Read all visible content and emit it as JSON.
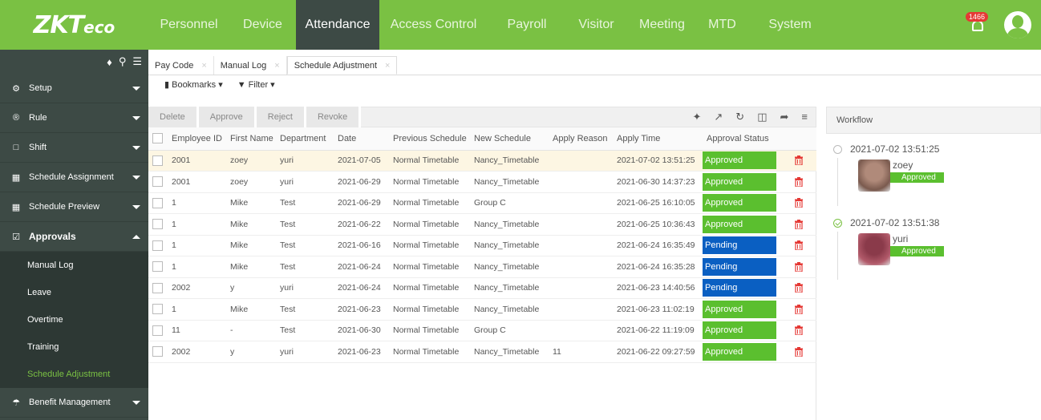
{
  "brand": {
    "logo_main": "ZKT",
    "logo_sub": "eco",
    "accent": "#7ac143",
    "dark": "#3d4a45"
  },
  "topnav": {
    "items": [
      "Personnel",
      "Device",
      "Attendance",
      "Access Control",
      "Payroll",
      "Visitor",
      "Meeting",
      "MTD",
      "System"
    ],
    "active": "Attendance",
    "notifications": "1466"
  },
  "sidebar": {
    "items": [
      {
        "label": "Setup",
        "icon": "gear-icon"
      },
      {
        "label": "Rule",
        "icon": "registered-icon"
      },
      {
        "label": "Shift",
        "icon": "folder-icon"
      },
      {
        "label": "Schedule Assignment",
        "icon": "calendar-icon"
      },
      {
        "label": "Schedule Preview",
        "icon": "calendar-icon"
      },
      {
        "label": "Approvals",
        "icon": "checkbox-icon"
      }
    ],
    "sub_items": [
      "Manual Log",
      "Leave",
      "Overtime",
      "Training",
      "Schedule Adjustment"
    ],
    "bottom_item": {
      "label": "Benefit Management",
      "icon": "umbrella-icon"
    }
  },
  "tabs": [
    "Pay Code",
    "Manual Log",
    "Schedule Adjustment"
  ],
  "subtools": {
    "bookmarks": "Bookmarks",
    "filter": "Filter"
  },
  "actions": [
    "Delete",
    "Approve",
    "Reject",
    "Revoke"
  ],
  "table": {
    "columns": [
      "Employee ID",
      "First Name",
      "Department",
      "Date",
      "Previous Schedule",
      "New Schedule",
      "Apply Reason",
      "Apply Time",
      "Approval Status"
    ],
    "rows": [
      {
        "id": "2001",
        "first": "zoey",
        "dept": "yuri",
        "date": "2021-07-05",
        "prev": "Normal Timetable",
        "new": "Nancy_Timetable",
        "reason": "",
        "time": "2021-07-02 13:51:25",
        "status": "Approved"
      },
      {
        "id": "2001",
        "first": "zoey",
        "dept": "yuri",
        "date": "2021-06-29",
        "prev": "Normal Timetable",
        "new": "Nancy_Timetable",
        "reason": "",
        "time": "2021-06-30 14:37:23",
        "status": "Approved"
      },
      {
        "id": "1",
        "first": "Mike",
        "dept": "Test",
        "date": "2021-06-29",
        "prev": "Normal Timetable",
        "new": "Group C",
        "reason": "",
        "time": "2021-06-25 16:10:05",
        "status": "Approved"
      },
      {
        "id": "1",
        "first": "Mike",
        "dept": "Test",
        "date": "2021-06-22",
        "prev": "Normal Timetable",
        "new": "Nancy_Timetable",
        "reason": "",
        "time": "2021-06-25 10:36:43",
        "status": "Approved"
      },
      {
        "id": "1",
        "first": "Mike",
        "dept": "Test",
        "date": "2021-06-16",
        "prev": "Normal Timetable",
        "new": "Nancy_Timetable",
        "reason": "",
        "time": "2021-06-24 16:35:49",
        "status": "Pending"
      },
      {
        "id": "1",
        "first": "Mike",
        "dept": "Test",
        "date": "2021-06-24",
        "prev": "Normal Timetable",
        "new": "Nancy_Timetable",
        "reason": "",
        "time": "2021-06-24 16:35:28",
        "status": "Pending"
      },
      {
        "id": "2002",
        "first": "y",
        "dept": "yuri",
        "date": "2021-06-24",
        "prev": "Normal Timetable",
        "new": "Nancy_Timetable",
        "reason": "",
        "time": "2021-06-23 14:40:56",
        "status": "Pending"
      },
      {
        "id": "1",
        "first": "Mike",
        "dept": "Test",
        "date": "2021-06-23",
        "prev": "Normal Timetable",
        "new": "Nancy_Timetable",
        "reason": "",
        "time": "2021-06-23 11:02:19",
        "status": "Approved"
      },
      {
        "id": "11",
        "first": "-",
        "dept": "Test",
        "date": "2021-06-30",
        "prev": "Normal Timetable",
        "new": "Group C",
        "reason": "",
        "time": "2021-06-22 11:19:09",
        "status": "Approved"
      },
      {
        "id": "2002",
        "first": "y",
        "dept": "yuri",
        "date": "2021-06-23",
        "prev": "Normal Timetable",
        "new": "Nancy_Timetable",
        "reason": "11",
        "time": "2021-06-22 09:27:59",
        "status": "Approved"
      }
    ]
  },
  "workflow": {
    "title": "Workflow",
    "entries": [
      {
        "time": "2021-07-02 13:51:25",
        "name": "zoey",
        "status": "Approved",
        "done": false
      },
      {
        "time": "2021-07-02 13:51:38",
        "name": "yuri",
        "status": "Approved",
        "done": true
      }
    ]
  }
}
